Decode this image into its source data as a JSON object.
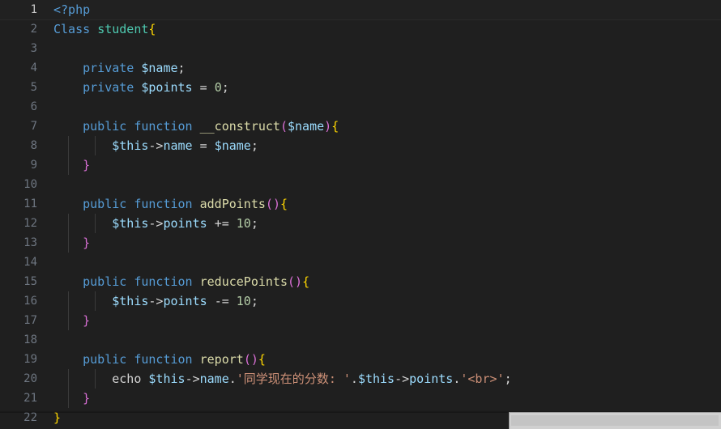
{
  "editor": {
    "language": "php",
    "background_color": "#1f1f1f",
    "gutter_color": "#6e7681",
    "active_gutter_color": "#c8c8c8",
    "default_text_color": "#d4d4d4",
    "palette": {
      "tag": "#569cd6",
      "keyword": "#569cd6",
      "class_name": "#4ec9b0",
      "function_name": "#dcdcaa",
      "variable": "#9cdcfe",
      "number": "#b5cea8",
      "string": "#ce9178",
      "brace_yellow": "#ffd700",
      "brace_magenta": "#da70d6",
      "paren_magenta": "#da70d6"
    },
    "active_line": 1,
    "lines": [
      {
        "number": "1",
        "text": "<?php",
        "tokens": [
          {
            "t": "<?php",
            "c": "tok-tag"
          }
        ]
      },
      {
        "number": "2",
        "text": "Class student{",
        "tokens": [
          {
            "t": "Class",
            "c": "tok-keyword"
          },
          {
            "t": " ",
            "c": "tok-plain"
          },
          {
            "t": "student",
            "c": "tok-class"
          },
          {
            "t": "{",
            "c": "tok-brace-y"
          }
        ]
      },
      {
        "number": "3",
        "text": "",
        "tokens": []
      },
      {
        "number": "4",
        "text": "    private $name;",
        "tokens": [
          {
            "t": "    ",
            "c": "tok-plain"
          },
          {
            "t": "private",
            "c": "tok-keyword"
          },
          {
            "t": " ",
            "c": "tok-plain"
          },
          {
            "t": "$name",
            "c": "tok-var"
          },
          {
            "t": ";",
            "c": "tok-plain"
          }
        ]
      },
      {
        "number": "5",
        "text": "    private $points = 0;",
        "tokens": [
          {
            "t": "    ",
            "c": "tok-plain"
          },
          {
            "t": "private",
            "c": "tok-keyword"
          },
          {
            "t": " ",
            "c": "tok-plain"
          },
          {
            "t": "$points",
            "c": "tok-var"
          },
          {
            "t": " ",
            "c": "tok-plain"
          },
          {
            "t": "=",
            "c": "tok-op"
          },
          {
            "t": " ",
            "c": "tok-plain"
          },
          {
            "t": "0",
            "c": "tok-num"
          },
          {
            "t": ";",
            "c": "tok-plain"
          }
        ]
      },
      {
        "number": "6",
        "text": "",
        "tokens": []
      },
      {
        "number": "7",
        "text": "    public function __construct($name){",
        "tokens": [
          {
            "t": "    ",
            "c": "tok-plain"
          },
          {
            "t": "public",
            "c": "tok-keyword"
          },
          {
            "t": " ",
            "c": "tok-plain"
          },
          {
            "t": "function",
            "c": "tok-keyword"
          },
          {
            "t": " ",
            "c": "tok-plain"
          },
          {
            "t": "__construct",
            "c": "tok-func"
          },
          {
            "t": "(",
            "c": "tok-paren-m"
          },
          {
            "t": "$name",
            "c": "tok-var"
          },
          {
            "t": ")",
            "c": "tok-paren-m"
          },
          {
            "t": "{",
            "c": "tok-brace-y"
          }
        ]
      },
      {
        "number": "8",
        "text": "        $this->name = $name;",
        "tokens": [
          {
            "t": "        ",
            "c": "tok-plain"
          },
          {
            "t": "$this",
            "c": "tok-var"
          },
          {
            "t": "->",
            "c": "tok-plain"
          },
          {
            "t": "name",
            "c": "tok-prop"
          },
          {
            "t": " ",
            "c": "tok-plain"
          },
          {
            "t": "=",
            "c": "tok-op"
          },
          {
            "t": " ",
            "c": "tok-plain"
          },
          {
            "t": "$name",
            "c": "tok-var"
          },
          {
            "t": ";",
            "c": "tok-plain"
          }
        ]
      },
      {
        "number": "9",
        "text": "    }",
        "tokens": [
          {
            "t": "    ",
            "c": "tok-plain"
          },
          {
            "t": "}",
            "c": "tok-brace-m"
          }
        ]
      },
      {
        "number": "10",
        "text": "",
        "tokens": []
      },
      {
        "number": "11",
        "text": "    public function addPoints(){",
        "tokens": [
          {
            "t": "    ",
            "c": "tok-plain"
          },
          {
            "t": "public",
            "c": "tok-keyword"
          },
          {
            "t": " ",
            "c": "tok-plain"
          },
          {
            "t": "function",
            "c": "tok-keyword"
          },
          {
            "t": " ",
            "c": "tok-plain"
          },
          {
            "t": "addPoints",
            "c": "tok-func"
          },
          {
            "t": "(",
            "c": "tok-paren-m"
          },
          {
            "t": ")",
            "c": "tok-paren-m"
          },
          {
            "t": "{",
            "c": "tok-brace-y"
          }
        ]
      },
      {
        "number": "12",
        "text": "        $this->points += 10;",
        "tokens": [
          {
            "t": "        ",
            "c": "tok-plain"
          },
          {
            "t": "$this",
            "c": "tok-var"
          },
          {
            "t": "->",
            "c": "tok-plain"
          },
          {
            "t": "points",
            "c": "tok-prop"
          },
          {
            "t": " ",
            "c": "tok-plain"
          },
          {
            "t": "+=",
            "c": "tok-op"
          },
          {
            "t": " ",
            "c": "tok-plain"
          },
          {
            "t": "10",
            "c": "tok-num"
          },
          {
            "t": ";",
            "c": "tok-plain"
          }
        ]
      },
      {
        "number": "13",
        "text": "    }",
        "tokens": [
          {
            "t": "    ",
            "c": "tok-plain"
          },
          {
            "t": "}",
            "c": "tok-brace-m"
          }
        ]
      },
      {
        "number": "14",
        "text": "",
        "tokens": []
      },
      {
        "number": "15",
        "text": "    public function reducePoints(){",
        "tokens": [
          {
            "t": "    ",
            "c": "tok-plain"
          },
          {
            "t": "public",
            "c": "tok-keyword"
          },
          {
            "t": " ",
            "c": "tok-plain"
          },
          {
            "t": "function",
            "c": "tok-keyword"
          },
          {
            "t": " ",
            "c": "tok-plain"
          },
          {
            "t": "reducePoints",
            "c": "tok-func"
          },
          {
            "t": "(",
            "c": "tok-paren-m"
          },
          {
            "t": ")",
            "c": "tok-paren-m"
          },
          {
            "t": "{",
            "c": "tok-brace-y"
          }
        ]
      },
      {
        "number": "16",
        "text": "        $this->points -= 10;",
        "tokens": [
          {
            "t": "        ",
            "c": "tok-plain"
          },
          {
            "t": "$this",
            "c": "tok-var"
          },
          {
            "t": "->",
            "c": "tok-plain"
          },
          {
            "t": "points",
            "c": "tok-prop"
          },
          {
            "t": " ",
            "c": "tok-plain"
          },
          {
            "t": "-=",
            "c": "tok-op"
          },
          {
            "t": " ",
            "c": "tok-plain"
          },
          {
            "t": "10",
            "c": "tok-num"
          },
          {
            "t": ";",
            "c": "tok-plain"
          }
        ]
      },
      {
        "number": "17",
        "text": "    }",
        "tokens": [
          {
            "t": "    ",
            "c": "tok-plain"
          },
          {
            "t": "}",
            "c": "tok-brace-m"
          }
        ]
      },
      {
        "number": "18",
        "text": "",
        "tokens": []
      },
      {
        "number": "19",
        "text": "    public function report(){",
        "tokens": [
          {
            "t": "    ",
            "c": "tok-plain"
          },
          {
            "t": "public",
            "c": "tok-keyword"
          },
          {
            "t": " ",
            "c": "tok-plain"
          },
          {
            "t": "function",
            "c": "tok-keyword"
          },
          {
            "t": " ",
            "c": "tok-plain"
          },
          {
            "t": "report",
            "c": "tok-func"
          },
          {
            "t": "(",
            "c": "tok-paren-m"
          },
          {
            "t": ")",
            "c": "tok-paren-m"
          },
          {
            "t": "{",
            "c": "tok-brace-y"
          }
        ]
      },
      {
        "number": "20",
        "text": "        echo $this->name.'同学现在的分数: '.$this->points.'<br>';",
        "tokens": [
          {
            "t": "        ",
            "c": "tok-plain"
          },
          {
            "t": "echo",
            "c": "tok-echo"
          },
          {
            "t": " ",
            "c": "tok-plain"
          },
          {
            "t": "$this",
            "c": "tok-var"
          },
          {
            "t": "->",
            "c": "tok-plain"
          },
          {
            "t": "name",
            "c": "tok-prop"
          },
          {
            "t": ".",
            "c": "tok-plain"
          },
          {
            "t": "'同学现在的分数: '",
            "c": "tok-string"
          },
          {
            "t": ".",
            "c": "tok-plain"
          },
          {
            "t": "$this",
            "c": "tok-var"
          },
          {
            "t": "->",
            "c": "tok-plain"
          },
          {
            "t": "points",
            "c": "tok-prop"
          },
          {
            "t": ".",
            "c": "tok-plain"
          },
          {
            "t": "'<br>'",
            "c": "tok-string"
          },
          {
            "t": ";",
            "c": "tok-plain"
          }
        ]
      },
      {
        "number": "21",
        "text": "    }",
        "tokens": [
          {
            "t": "    ",
            "c": "tok-plain"
          },
          {
            "t": "}",
            "c": "tok-brace-m"
          }
        ]
      },
      {
        "number": "22",
        "text": "}",
        "tokens": [
          {
            "t": "}",
            "c": "tok-brace-y"
          }
        ]
      }
    ],
    "indent_guides": {
      "level1_lines": [
        "8",
        "9",
        "12",
        "13",
        "16",
        "17",
        "20",
        "21"
      ],
      "level2_lines": [
        "8",
        "12",
        "16",
        "20"
      ]
    }
  }
}
